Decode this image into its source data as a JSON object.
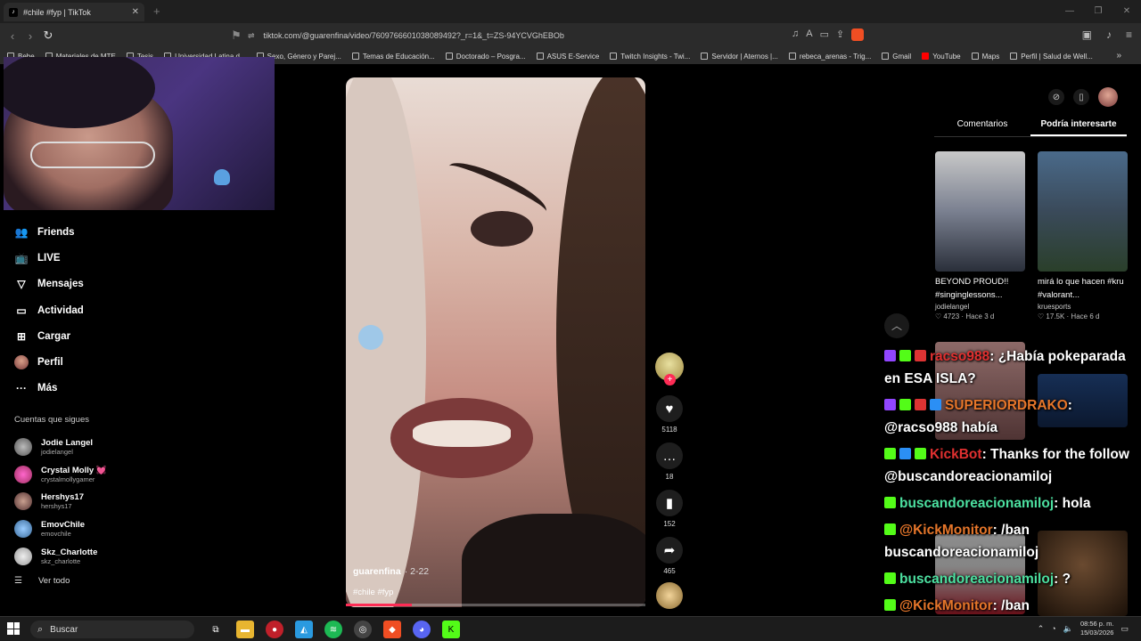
{
  "browser": {
    "tab_title": "#chile #fyp | TikTok",
    "url": "tiktok.com/@guarenfina/video/7609766601038089492?_r=1&_t=ZS-94YCVGhEBOb",
    "bookmarks": [
      "Bebe",
      "Materiales de MTE",
      "Tesis",
      "Universidad Latina d...",
      "Sexo, Género y Parej...",
      "Temas de Educación...",
      "Doctorado – Posgra...",
      "ASUS E-Service",
      "Twitch Insights - Twi...",
      "Servidor | Aternos |...",
      "rebeca_arenas - Trig...",
      "Gmail",
      "YouTube",
      "Maps",
      "Perfil | Salud de Well..."
    ]
  },
  "sidebar": {
    "nav": [
      {
        "label": "Friends",
        "icon": "friends-icon"
      },
      {
        "label": "LIVE",
        "icon": "live-icon"
      },
      {
        "label": "Mensajes",
        "icon": "messages-icon"
      },
      {
        "label": "Actividad",
        "icon": "activity-icon"
      },
      {
        "label": "Cargar",
        "icon": "upload-icon"
      },
      {
        "label": "Perfil",
        "icon": "profile-avatar"
      },
      {
        "label": "Más",
        "icon": "more-icon"
      }
    ],
    "following_title": "Cuentas que sigues",
    "following": [
      {
        "name": "Jodie Langel",
        "handle": "jodielangel"
      },
      {
        "name": "Crystal Molly 💓",
        "handle": "crystalmollygamer"
      },
      {
        "name": "Hershys17",
        "handle": "hershys17"
      },
      {
        "name": "EmovChile",
        "handle": "emovchile"
      },
      {
        "name": "Skz_Charlotte",
        "handle": "skz_charlotte"
      }
    ],
    "see_all": "Ver todo"
  },
  "video": {
    "author": "guarenfina",
    "date": "2-22",
    "tags": "#chile #fyp",
    "progress": 0.22,
    "likes": "5118",
    "comments": "18",
    "saves": "152",
    "shares": "465"
  },
  "right_panel": {
    "tabs": [
      "Comentarios",
      "Podría interesarte"
    ],
    "cards": [
      {
        "title": "BEYOND PROUD!! #singinglessons...",
        "user": "jodielangel",
        "likes": "4723",
        "age": "Hace 3 d"
      },
      {
        "title": "mirá lo que hacen #kru #valorant...",
        "user": "kruesports",
        "likes": "17.5K",
        "age": "Hace 6 d"
      }
    ]
  },
  "chat": [
    {
      "user": "racso988",
      "user_color": "red",
      "badges": [
        "tw",
        "gr",
        "red"
      ],
      "text": ": ¿Había pokeparada en ESA ISLA?"
    },
    {
      "user": "SUPERIORDRAKO",
      "user_color": "orange",
      "badges": [
        "tw",
        "gr",
        "red",
        "blue"
      ],
      "text": ": @racso988 había"
    },
    {
      "user": "KickBot",
      "user_color": "red",
      "badges": [
        "gr",
        "blue",
        "gr"
      ],
      "text": ": Thanks for the follow @buscandoreacionamiloj"
    },
    {
      "user": "buscandoreacionamiloj",
      "user_color": "green",
      "badges": [
        "gr"
      ],
      "text": ": hola"
    },
    {
      "user": "@KickMonitor",
      "user_color": "orange",
      "badges": [
        "gr"
      ],
      "text": ": /ban buscandoreacionamiloj"
    },
    {
      "user": "buscandoreacionamiloj",
      "user_color": "green",
      "badges": [
        "gr"
      ],
      "text": ": ?"
    },
    {
      "user": "@KickMonitor",
      "user_color": "orange",
      "badges": [
        "gr"
      ],
      "text": ": /ban buscandoreacionamiloj"
    }
  ],
  "taskbar": {
    "search_placeholder": "Buscar",
    "time": "08:56 p. m.",
    "date": "15/03/2026"
  }
}
